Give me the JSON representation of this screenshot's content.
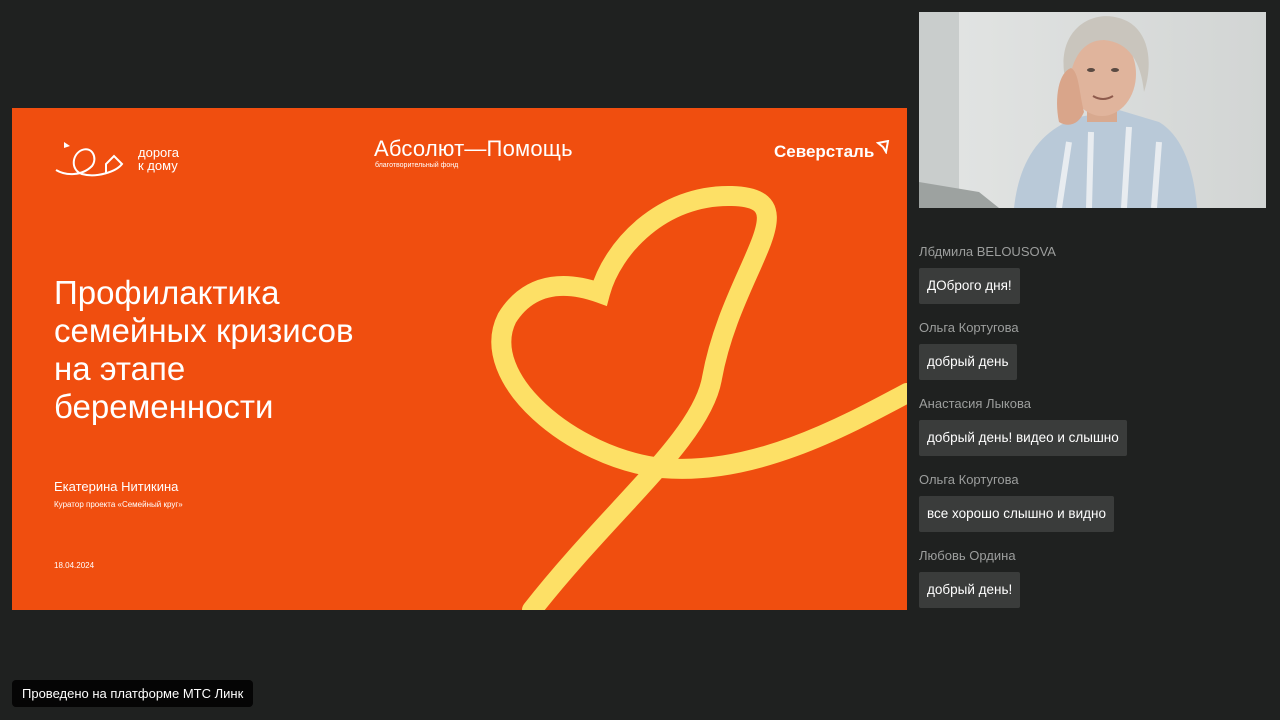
{
  "slide": {
    "logo_left_line1": "дорога",
    "logo_left_line2": "к дому",
    "logo_center_main": "Абсолют—Помощь",
    "logo_center_sub": "благотворительный фонд",
    "logo_right": "Северсталь",
    "title_lines": [
      "Профилактика",
      "семейных кризисов",
      "на этапе",
      "беременности"
    ],
    "speaker_name": "Екатерина Нитикина",
    "speaker_role": "Куратор проекта «Семейный круг»",
    "date": "18.04.2024",
    "colors": {
      "background": "#f04e0f",
      "heart": "#fde066",
      "text": "#ffffff"
    }
  },
  "chat": {
    "messages": [
      {
        "author": "Лбдмила BELOUSOVA",
        "text": "ДОброго дня!"
      },
      {
        "author": "Ольга Кортугова",
        "text": "добрый день"
      },
      {
        "author": "Анастасия Лыкова",
        "text": "добрый день! видео и слышно"
      },
      {
        "author": "Ольга Кортугова",
        "text": "все хорошо слышно и видно"
      },
      {
        "author": "Любовь Ордина",
        "text": "добрый день!"
      }
    ]
  },
  "footer": {
    "platform_badge": "Проведено на платформе МТС Линк"
  },
  "video": {
    "icon": "participant-video-feed"
  }
}
